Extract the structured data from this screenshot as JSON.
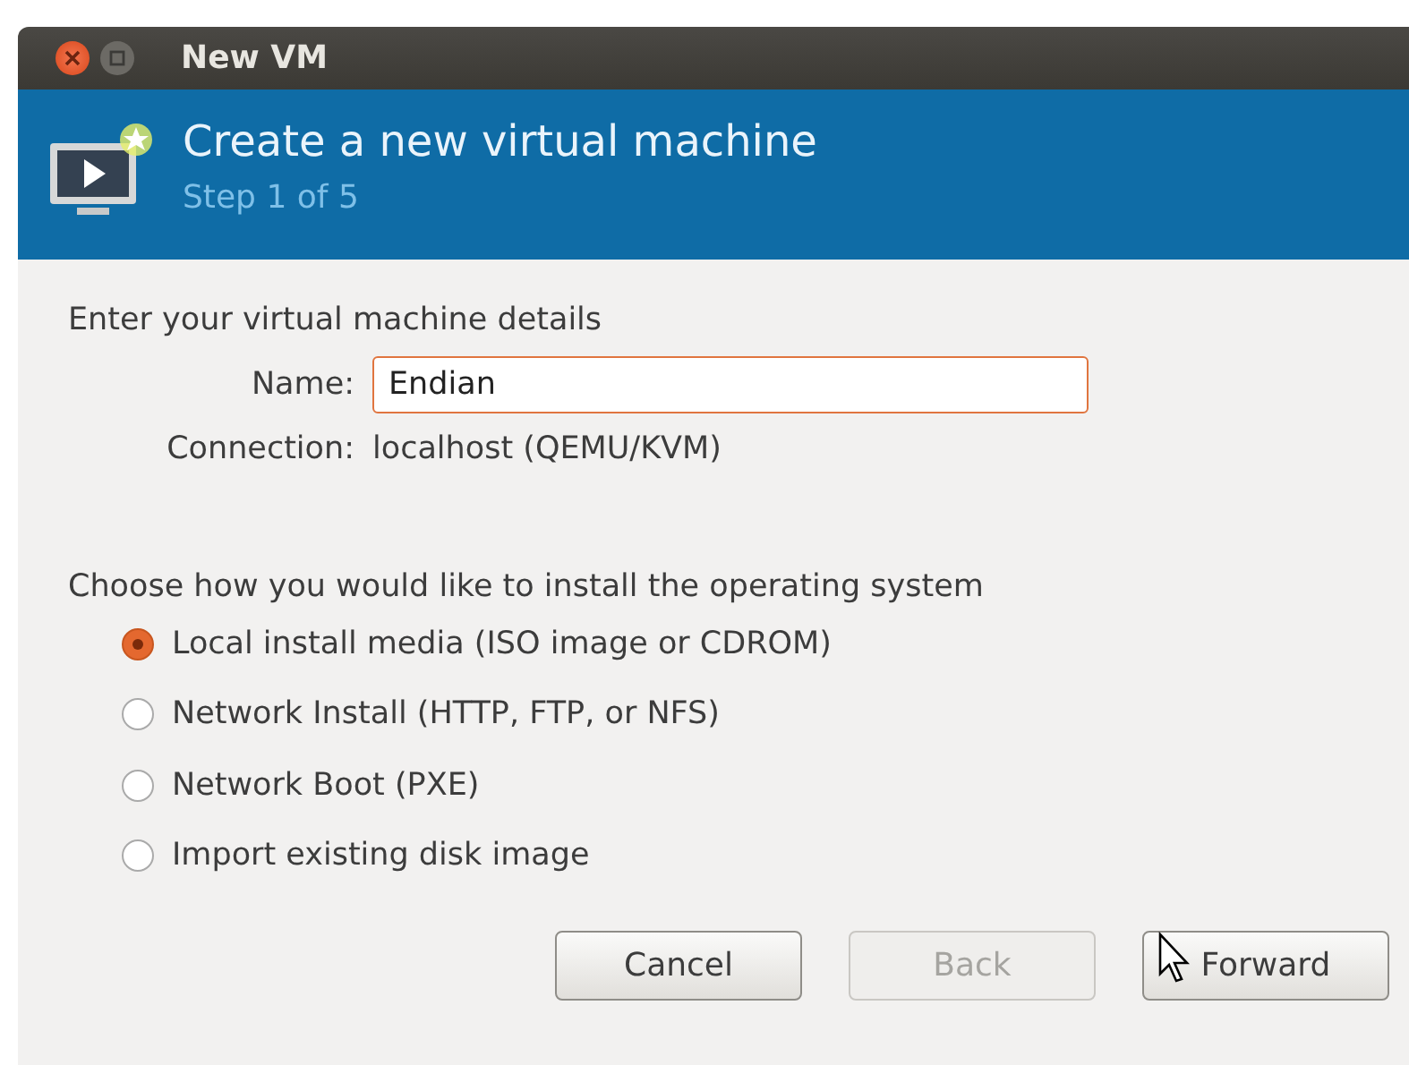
{
  "window": {
    "title": "New VM"
  },
  "header": {
    "title": "Create a new virtual machine",
    "subtitle": "Step 1 of 5"
  },
  "details": {
    "heading": "Enter your virtual machine details",
    "name_label": "Name:",
    "name_value": "Endian",
    "connection_label": "Connection:",
    "connection_value": "localhost (QEMU/KVM)"
  },
  "install": {
    "heading": "Choose how you would like to install the operating system",
    "options": [
      {
        "label": "Local install media (ISO image or CDROM)",
        "selected": true
      },
      {
        "label": "Network Install (HTTP, FTP, or NFS)",
        "selected": false
      },
      {
        "label": "Network Boot (PXE)",
        "selected": false
      },
      {
        "label": "Import existing disk image",
        "selected": false
      }
    ]
  },
  "buttons": [
    {
      "label": "Cancel",
      "disabled": false
    },
    {
      "label": "Back",
      "disabled": true
    },
    {
      "label": "Forward",
      "disabled": false
    }
  ]
}
